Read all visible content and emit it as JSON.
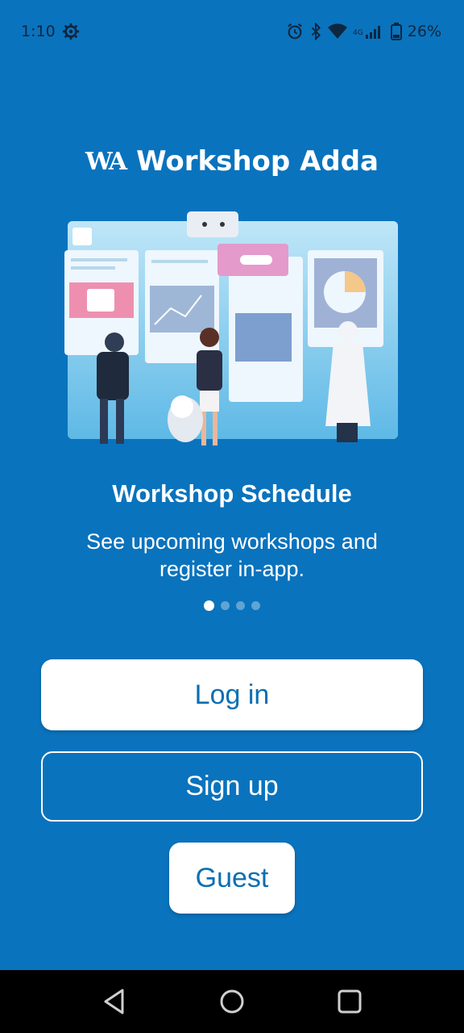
{
  "status_bar": {
    "time": "1:10",
    "battery": "26%",
    "icons": [
      "settings-gear-icon",
      "alarm-icon",
      "bluetooth-icon",
      "wifi-icon",
      "signal-icon",
      "battery-icon"
    ]
  },
  "brand": {
    "mark": "WA",
    "name": "Workshop Adda"
  },
  "onboarding": {
    "title": "Workshop Schedule",
    "description": "See upcoming workshops and register in-app.",
    "page_count": 4,
    "active_page": 1
  },
  "actions": {
    "login_label": "Log in",
    "signup_label": "Sign up",
    "guest_label": "Guest"
  },
  "nav_bar": {
    "icons": [
      "back-icon",
      "home-icon",
      "recents-icon"
    ]
  },
  "colors": {
    "background": "#0a73bd",
    "button_text": "#0a6fb3",
    "white": "#ffffff"
  }
}
